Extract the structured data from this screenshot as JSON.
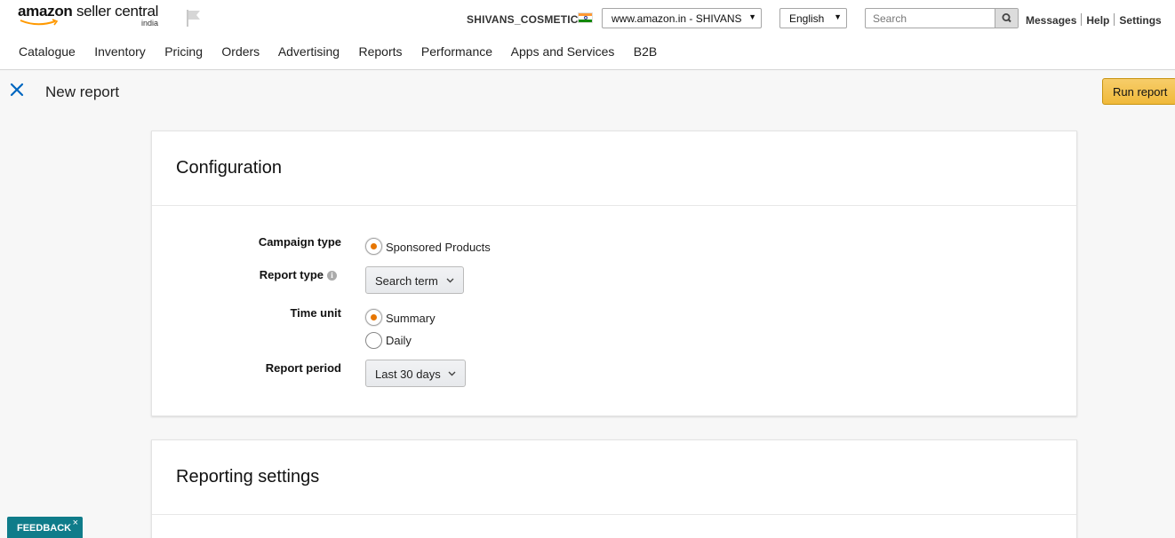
{
  "header": {
    "logo_brand": "amazon",
    "logo_product": "seller central",
    "logo_region": "india",
    "account_name": "SHIVANS_COSMETIC",
    "marketplace": "www.amazon.in - SHIVANS",
    "language": "English",
    "search_placeholder": "Search",
    "links": {
      "messages": "Messages",
      "help": "Help",
      "settings": "Settings"
    }
  },
  "nav": {
    "items": [
      "Catalogue",
      "Inventory",
      "Pricing",
      "Orders",
      "Advertising",
      "Reports",
      "Performance",
      "Apps and Services",
      "B2B"
    ]
  },
  "page": {
    "title": "New report",
    "run_button": "Run report"
  },
  "configuration": {
    "title": "Configuration",
    "campaign_type": {
      "label": "Campaign type",
      "option": "Sponsored Products",
      "selected": true
    },
    "report_type": {
      "label": "Report type",
      "value": "Search term"
    },
    "time_unit": {
      "label": "Time unit",
      "options": [
        "Summary",
        "Daily"
      ],
      "selected": "Summary"
    },
    "report_period": {
      "label": "Report period",
      "value": "Last 30 days"
    }
  },
  "reporting_settings": {
    "title": "Reporting settings"
  },
  "feedback": {
    "label": "FEEDBACK",
    "close": "×"
  },
  "colors": {
    "accent_radio": "#e77600",
    "run_button": "#f0c14b",
    "feedback": "#0f7c8a",
    "close_icon": "#0066c0"
  }
}
